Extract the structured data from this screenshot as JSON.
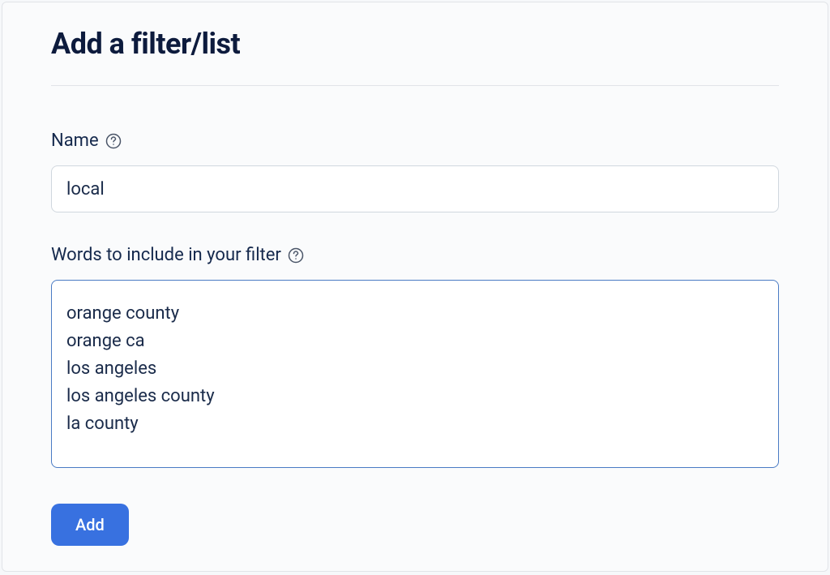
{
  "form": {
    "title": "Add a filter/list",
    "name": {
      "label": "Name",
      "value": "local"
    },
    "words": {
      "label": "Words to include in your filter",
      "value": "orange county\norange ca\nlos angeles\nlos angeles county\nla county"
    },
    "submit_label": "Add"
  }
}
